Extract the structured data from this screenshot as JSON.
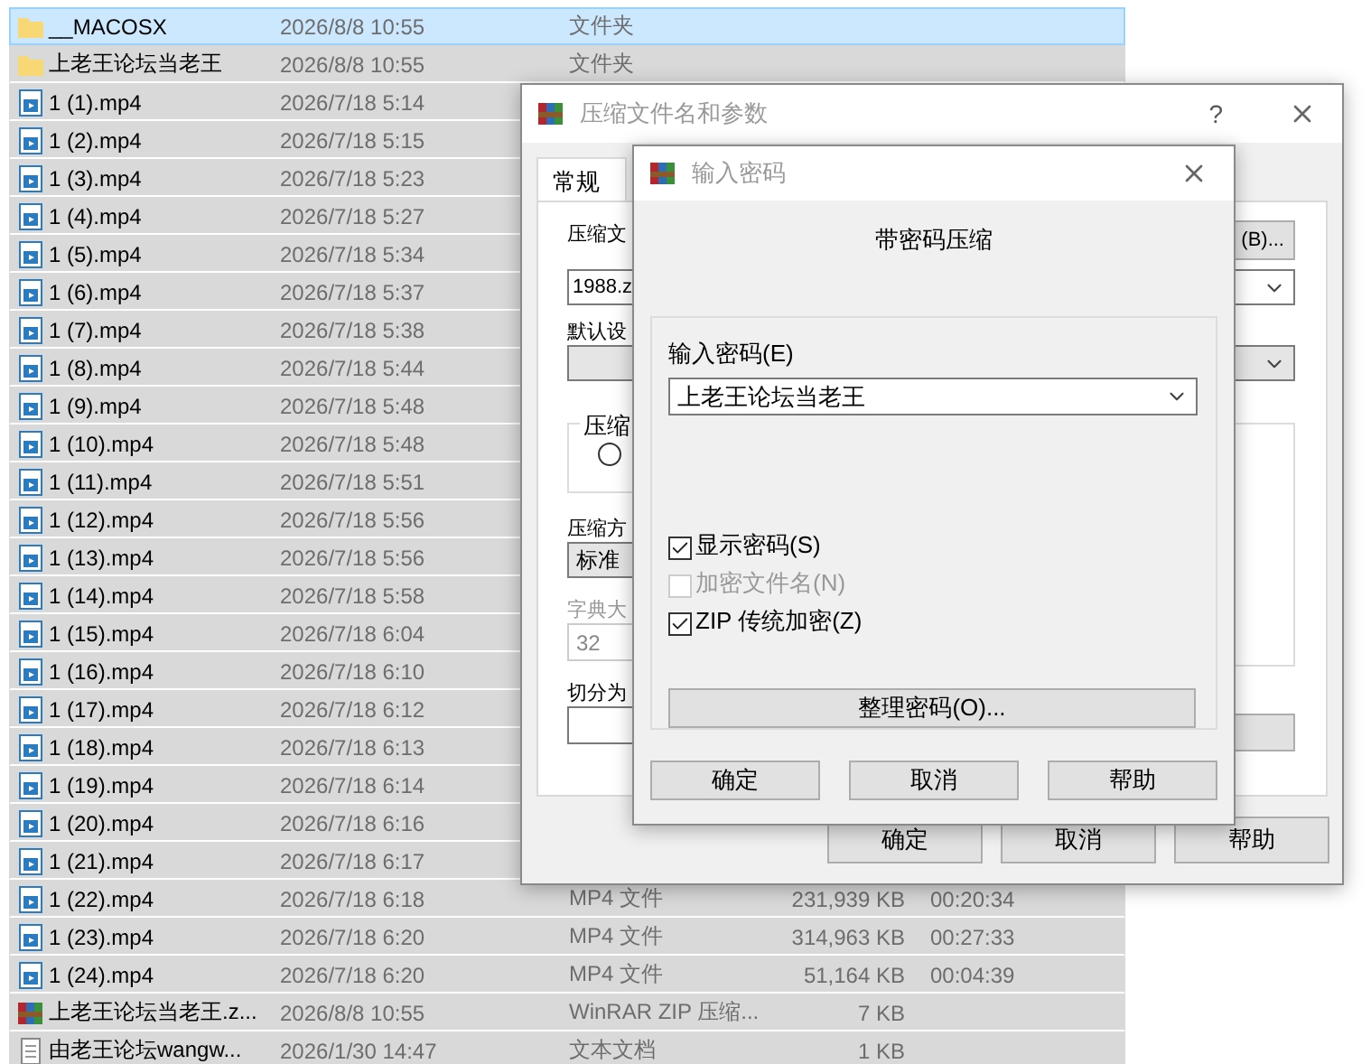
{
  "file_list": {
    "rows": [
      {
        "kind": "folder",
        "name": "__MACOSX",
        "date": "2026/8/8 10:55",
        "type": "文件夹",
        "selected": true,
        "focused": true
      },
      {
        "kind": "folder",
        "name": "上老王论坛当老王",
        "date": "2026/8/8 10:55",
        "type": "文件夹",
        "selected": true,
        "focused": false
      },
      {
        "kind": "video",
        "name": "1 (1).mp4",
        "date": "2026/7/18 5:14",
        "selected": true,
        "focused": false
      },
      {
        "kind": "video",
        "name": "1 (2).mp4",
        "date": "2026/7/18 5:15",
        "selected": true,
        "focused": false
      },
      {
        "kind": "video",
        "name": "1 (3).mp4",
        "date": "2026/7/18 5:23",
        "selected": true,
        "focused": false
      },
      {
        "kind": "video",
        "name": "1 (4).mp4",
        "date": "2026/7/18 5:27",
        "selected": true,
        "focused": false
      },
      {
        "kind": "video",
        "name": "1 (5).mp4",
        "date": "2026/7/18 5:34",
        "selected": true,
        "focused": false
      },
      {
        "kind": "video",
        "name": "1 (6).mp4",
        "date": "2026/7/18 5:37",
        "selected": true,
        "focused": false
      },
      {
        "kind": "video",
        "name": "1 (7).mp4",
        "date": "2026/7/18 5:38",
        "selected": true,
        "focused": false
      },
      {
        "kind": "video",
        "name": "1 (8).mp4",
        "date": "2026/7/18 5:44",
        "selected": true,
        "focused": false
      },
      {
        "kind": "video",
        "name": "1 (9).mp4",
        "date": "2026/7/18 5:48",
        "selected": true,
        "focused": false
      },
      {
        "kind": "video",
        "name": "1 (10).mp4",
        "date": "2026/7/18 5:48",
        "selected": true,
        "focused": false
      },
      {
        "kind": "video",
        "name": "1 (11).mp4",
        "date": "2026/7/18 5:51",
        "selected": true,
        "focused": false
      },
      {
        "kind": "video",
        "name": "1 (12).mp4",
        "date": "2026/7/18 5:56",
        "selected": true,
        "focused": false
      },
      {
        "kind": "video",
        "name": "1 (13).mp4",
        "date": "2026/7/18 5:56",
        "selected": true,
        "focused": false
      },
      {
        "kind": "video",
        "name": "1 (14).mp4",
        "date": "2026/7/18 5:58",
        "selected": true,
        "focused": false
      },
      {
        "kind": "video",
        "name": "1 (15).mp4",
        "date": "2026/7/18 6:04",
        "selected": true,
        "focused": false
      },
      {
        "kind": "video",
        "name": "1 (16).mp4",
        "date": "2026/7/18 6:10",
        "selected": true,
        "focused": false
      },
      {
        "kind": "video",
        "name": "1 (17).mp4",
        "date": "2026/7/18 6:12",
        "selected": true,
        "focused": false
      },
      {
        "kind": "video",
        "name": "1 (18).mp4",
        "date": "2026/7/18 6:13",
        "selected": true,
        "focused": false
      },
      {
        "kind": "video",
        "name": "1 (19).mp4",
        "date": "2026/7/18 6:14",
        "selected": true,
        "focused": false
      },
      {
        "kind": "video",
        "name": "1 (20).mp4",
        "date": "2026/7/18 6:16",
        "selected": true,
        "focused": false
      },
      {
        "kind": "video",
        "name": "1 (21).mp4",
        "date": "2026/7/18 6:17",
        "selected": true,
        "focused": false
      },
      {
        "kind": "video",
        "name": "1 (22).mp4",
        "date": "2026/7/18 6:18",
        "type": "MP4 文件",
        "size": "231,939 KB",
        "duration": "00:20:34",
        "selected": true,
        "focused": false
      },
      {
        "kind": "video",
        "name": "1 (23).mp4",
        "date": "2026/7/18 6:20",
        "type": "MP4 文件",
        "size": "314,963 KB",
        "duration": "00:27:33",
        "selected": true,
        "focused": false
      },
      {
        "kind": "video",
        "name": "1 (24).mp4",
        "date": "2026/7/18 6:20",
        "type": "MP4 文件",
        "size": "51,164 KB",
        "duration": "00:04:39",
        "selected": true,
        "focused": false
      },
      {
        "kind": "archive",
        "name": "上老王论坛当老王.z...",
        "date": "2026/8/8 10:55",
        "type": "WinRAR ZIP 压缩...",
        "size": "7 KB",
        "selected": true,
        "focused": false
      },
      {
        "kind": "text",
        "name": "由老王论坛wangw...",
        "date": "2026/1/30 14:47",
        "type": "文本文档",
        "size": "1 KB",
        "selected": true,
        "focused": false
      }
    ]
  },
  "archive_dialog": {
    "title": "压缩文件名和参数",
    "help": "?",
    "tabs": [
      {
        "label": "常规",
        "selected": true
      }
    ],
    "archive_name_label": "压缩文",
    "browse_button": "(B)...",
    "archive_name": "1988.z",
    "profile_label": "默认设",
    "format_group": "压缩",
    "format_option": {
      "selected": false
    },
    "method_label": "压缩方",
    "method": "标准",
    "dictionary_label": "字典大",
    "dictionary": "32",
    "split_label": "切分为",
    "buttons": [
      "确定",
      "取消",
      "帮助"
    ]
  },
  "password_dialog": {
    "title": "输入密码",
    "heading": "带密码压缩",
    "password_label": "输入密码(E)",
    "password": "上老王论坛当老王",
    "options": [
      {
        "label": "显示密码(S)",
        "checked": true,
        "disabled": false
      },
      {
        "label": "加密文件名(N)",
        "checked": false,
        "disabled": true
      },
      {
        "label": "ZIP 传统加密(Z)",
        "checked": true,
        "disabled": false
      }
    ],
    "organize_button": "整理密码(O)...",
    "buttons": [
      "确定",
      "取消",
      "帮助"
    ]
  }
}
